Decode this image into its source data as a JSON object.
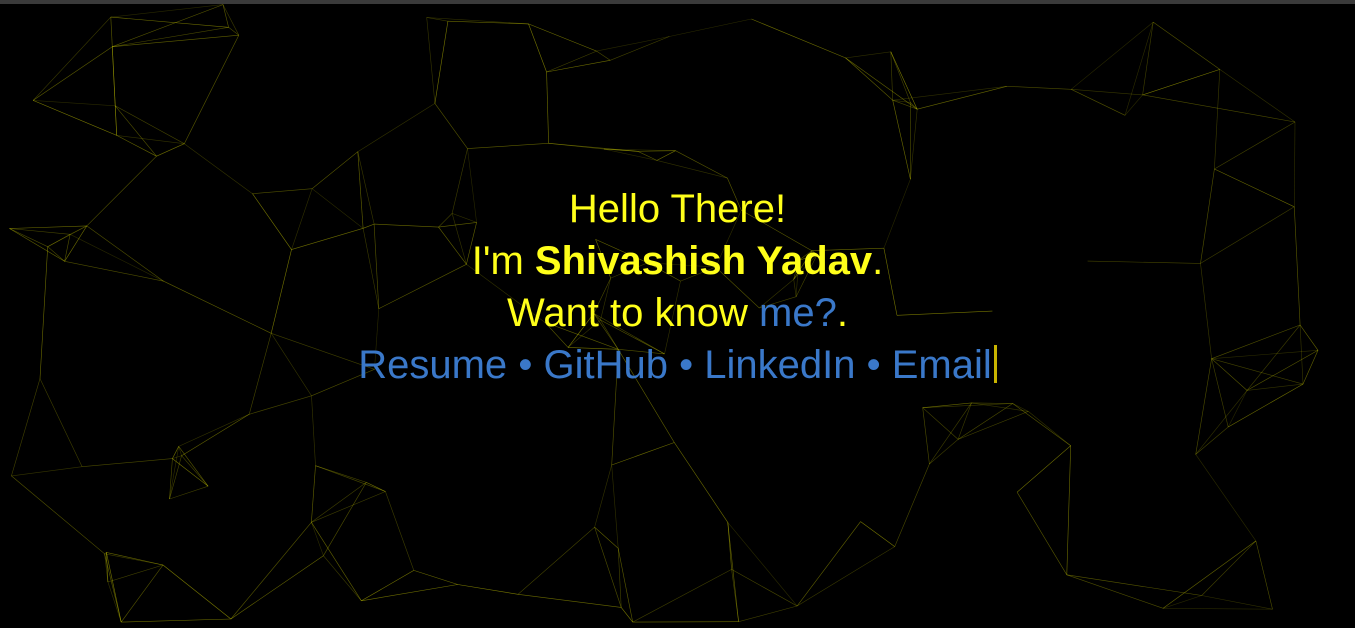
{
  "colors": {
    "background": "#000000",
    "text": "#ffff1a",
    "link": "#3a78c9",
    "network_line": "#e6e600",
    "cursor": "#c8b400"
  },
  "intro": {
    "greeting": "Hello There!",
    "name_prefix": "I'm ",
    "name": "Shivashish Yadav",
    "name_suffix": ".",
    "question_prefix": "Want to know ",
    "question_link": "me?",
    "question_suffix": "."
  },
  "links": {
    "resume": "Resume",
    "github": "GitHub",
    "linkedin": "LinkedIn",
    "email": "Email",
    "separator": "•"
  }
}
